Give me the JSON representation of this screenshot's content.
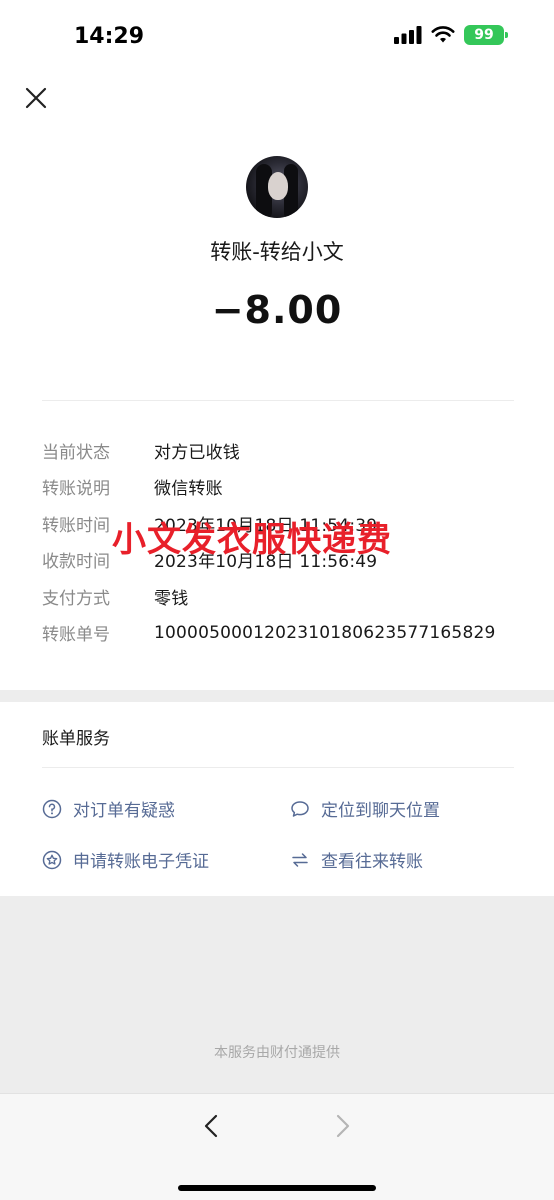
{
  "status_bar": {
    "time": "14:29",
    "battery": "99",
    "icons": [
      "signal-icon",
      "wifi-icon",
      "battery-icon"
    ]
  },
  "header": {
    "close_icon": "close-icon"
  },
  "transfer": {
    "title": "转账-转给小文",
    "amount": "−8.00"
  },
  "details": [
    {
      "label": "当前状态",
      "value": "对方已收钱"
    },
    {
      "label": "转账说明",
      "value": "微信转账"
    },
    {
      "label": "转账时间",
      "value": "2023年10月18日 11:54:39"
    },
    {
      "label": "收款时间",
      "value": "2023年10月18日 11:56:49"
    },
    {
      "label": "支付方式",
      "value": "零钱"
    },
    {
      "label": "转账单号",
      "value": "1000050001202310180623577165829"
    }
  ],
  "overlay_note": "小文发衣服快递费",
  "services": {
    "title": "账单服务",
    "items": [
      {
        "label": "对订单有疑惑",
        "icon": "question-circle-icon"
      },
      {
        "label": "定位到聊天位置",
        "icon": "chat-bubble-icon"
      },
      {
        "label": "申请转账电子凭证",
        "icon": "star-badge-icon"
      },
      {
        "label": "查看往来转账",
        "icon": "transfer-arrows-icon"
      }
    ]
  },
  "footer": {
    "provider_text": "本服务由财付通提供"
  },
  "colors": {
    "link": "#576b95",
    "overlay_red": "#e8202a",
    "battery_green": "#34c759",
    "background": "#ededed"
  }
}
